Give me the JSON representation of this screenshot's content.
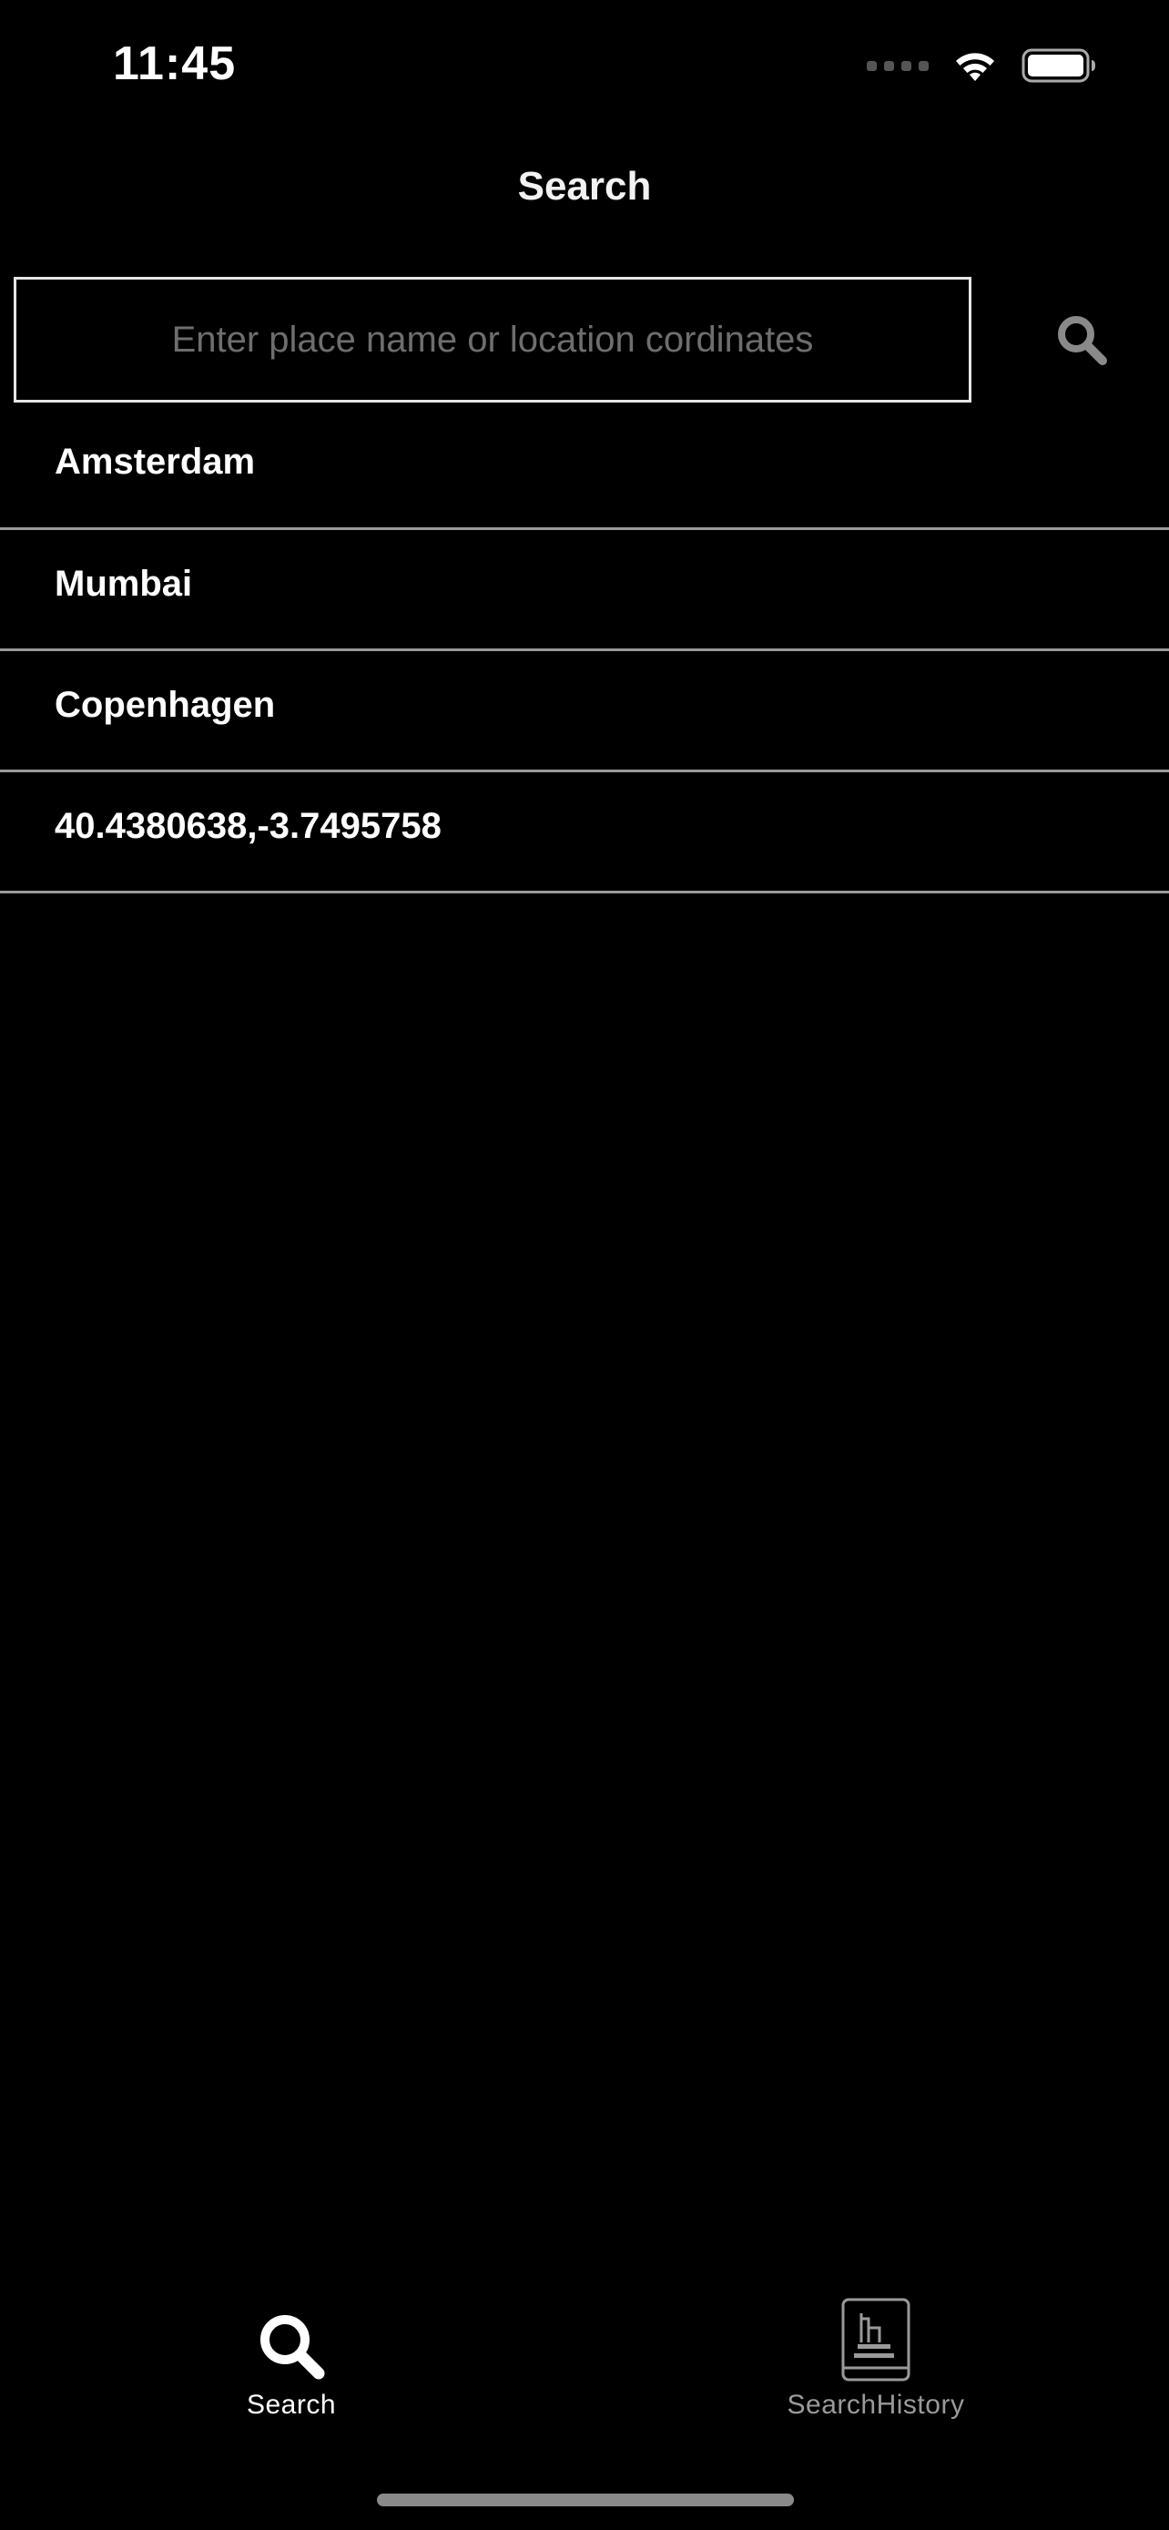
{
  "status_bar": {
    "time": "11:45",
    "signal_icon": "signal-dots-icon",
    "wifi_icon": "wifi-icon",
    "battery_icon": "battery-icon"
  },
  "nav": {
    "title": "Search"
  },
  "search": {
    "placeholder": "Enter place name or location cordinates",
    "value": "",
    "button_icon": "search-icon"
  },
  "results": [
    {
      "label": "Amsterdam"
    },
    {
      "label": "Mumbai"
    },
    {
      "label": "Copenhagen"
    },
    {
      "label": "40.4380638,-3.7495758"
    }
  ],
  "tab_bar": {
    "tabs": [
      {
        "label": "Search",
        "icon": "search-icon",
        "selected": true
      },
      {
        "label": "SearchHistory",
        "icon": "book-icon",
        "selected": false
      }
    ]
  },
  "colors": {
    "background": "#000000",
    "text": "#ffffff",
    "placeholder": "#6e6e6e",
    "divider": "#9a9a9a",
    "inactive_tab": "#9a9a9a"
  }
}
